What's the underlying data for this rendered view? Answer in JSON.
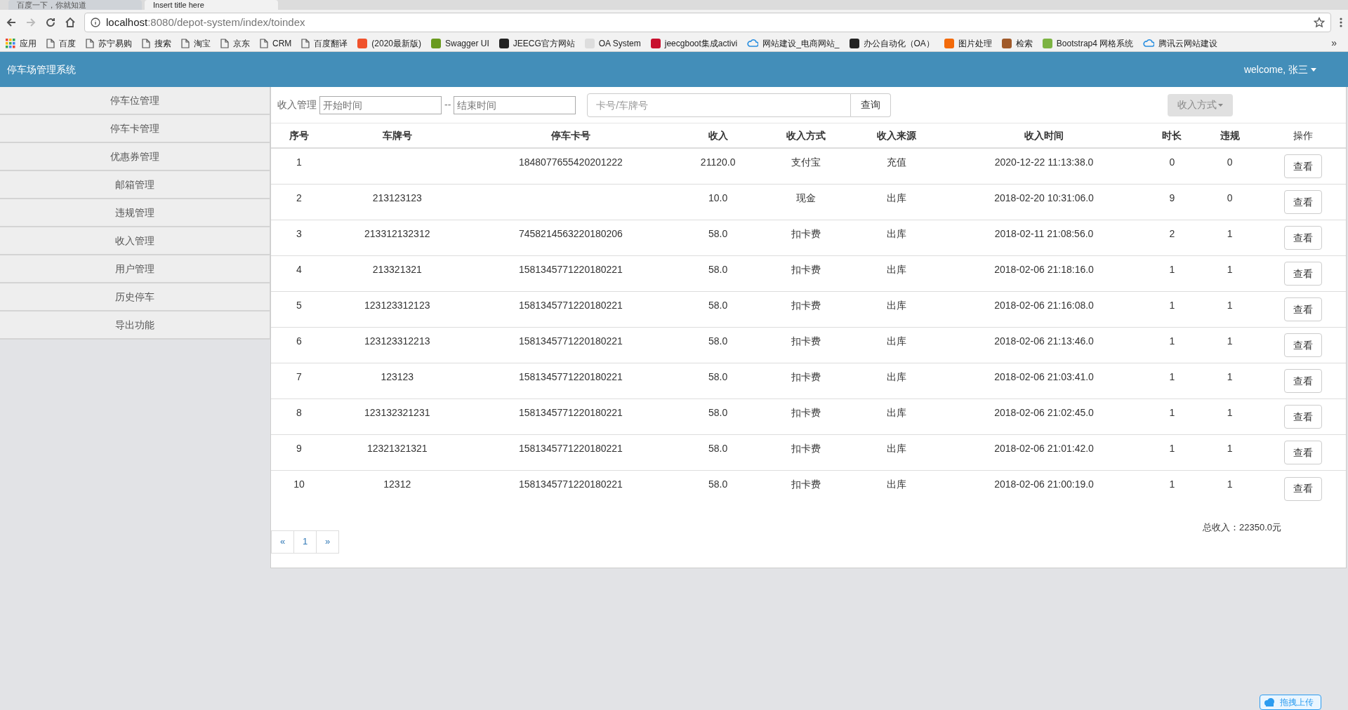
{
  "browser": {
    "tabs": [
      {
        "title": "百度一下，你就知道",
        "selected": false
      },
      {
        "title": "Insert title here",
        "selected": true
      }
    ],
    "url": {
      "host": "localhost",
      "rest": ":8080/depot-system/index/toindex"
    },
    "bookmarks": [
      {
        "label": "应用",
        "kind": "apps"
      },
      {
        "label": "百度",
        "kind": "page"
      },
      {
        "label": "苏宁易购",
        "kind": "page"
      },
      {
        "label": "搜索",
        "kind": "page"
      },
      {
        "label": "淘宝",
        "kind": "page"
      },
      {
        "label": "京东",
        "kind": "page"
      },
      {
        "label": "CRM",
        "kind": "page"
      },
      {
        "label": "百度翻译",
        "kind": "page"
      },
      {
        "label": "(2020最新版)",
        "kind": "site",
        "color": "#f0522c"
      },
      {
        "label": "Swagger UI",
        "kind": "site",
        "color": "#6a9a1f"
      },
      {
        "label": "JEECG官方网站",
        "kind": "site",
        "color": "#222222"
      },
      {
        "label": "OA System",
        "kind": "site",
        "color": "#dddddd"
      },
      {
        "label": "jeecgboot集成activi",
        "kind": "site",
        "color": "#c8102e"
      },
      {
        "label": "网站建设_电商网站_",
        "kind": "cloud",
        "color": "#2a8fe0"
      },
      {
        "label": "办公自动化（OA）",
        "kind": "site",
        "color": "#222222"
      },
      {
        "label": "图片处理",
        "kind": "site",
        "color": "#f36a0a"
      },
      {
        "label": "检索",
        "kind": "site",
        "color": "#a05a2a"
      },
      {
        "label": "Bootstrap4 网格系统",
        "kind": "site",
        "color": "#7cb342"
      },
      {
        "label": "腾讯云网站建设",
        "kind": "cloud",
        "color": "#2a8fe0"
      }
    ],
    "more": "»"
  },
  "header": {
    "title": "停车场管理系统",
    "user": "welcome, 张三"
  },
  "sidebar": {
    "items": [
      {
        "label": "停车位管理"
      },
      {
        "label": "停车卡管理"
      },
      {
        "label": "优惠券管理"
      },
      {
        "label": "邮箱管理"
      },
      {
        "label": "违规管理"
      },
      {
        "label": "收入管理"
      },
      {
        "label": "用户管理"
      },
      {
        "label": "历史停车"
      },
      {
        "label": "导出功能"
      }
    ]
  },
  "toolbar": {
    "label": "收入管理",
    "start": {
      "placeholder": "开始时间"
    },
    "separator": "--",
    "end": {
      "placeholder": "结束时间"
    },
    "search": {
      "placeholder": "卡号/车牌号"
    },
    "search_button": "查询",
    "dropdown": "收入方式"
  },
  "table": {
    "columns": [
      {
        "label": "序号",
        "bold": true
      },
      {
        "label": "车牌号",
        "bold": true
      },
      {
        "label": "停车卡号",
        "bold": true
      },
      {
        "label": "收入",
        "bold": true
      },
      {
        "label": "收入方式",
        "bold": true
      },
      {
        "label": "收入来源",
        "bold": true
      },
      {
        "label": "收入时间",
        "bold": true
      },
      {
        "label": "时长",
        "bold": true
      },
      {
        "label": "违规",
        "bold": true
      },
      {
        "label": "操作",
        "bold": false
      }
    ],
    "rows": [
      {
        "cells": [
          "1",
          "",
          "1848077655420201222",
          "21120.0",
          "支付宝",
          "充值",
          "2020-12-22 11:13:38.0",
          "0",
          "0"
        ],
        "action": "查看"
      },
      {
        "cells": [
          "2",
          "213123123",
          "",
          "10.0",
          "现金",
          "出库",
          "2018-02-20 10:31:06.0",
          "9",
          "0"
        ],
        "action": "查看"
      },
      {
        "cells": [
          "3",
          "213312132312",
          "7458214563220180206",
          "58.0",
          "扣卡费",
          "出库",
          "2018-02-11 21:08:56.0",
          "2",
          "1"
        ],
        "action": "查看"
      },
      {
        "cells": [
          "4",
          "213321321",
          "1581345771220180221",
          "58.0",
          "扣卡费",
          "出库",
          "2018-02-06 21:18:16.0",
          "1",
          "1"
        ],
        "action": "查看"
      },
      {
        "cells": [
          "5",
          "123123312123",
          "1581345771220180221",
          "58.0",
          "扣卡费",
          "出库",
          "2018-02-06 21:16:08.0",
          "1",
          "1"
        ],
        "action": "查看"
      },
      {
        "cells": [
          "6",
          "123123312213",
          "1581345771220180221",
          "58.0",
          "扣卡费",
          "出库",
          "2018-02-06 21:13:46.0",
          "1",
          "1"
        ],
        "action": "查看"
      },
      {
        "cells": [
          "7",
          "123123",
          "1581345771220180221",
          "58.0",
          "扣卡费",
          "出库",
          "2018-02-06 21:03:41.0",
          "1",
          "1"
        ],
        "action": "查看"
      },
      {
        "cells": [
          "8",
          "123132321231",
          "1581345771220180221",
          "58.0",
          "扣卡费",
          "出库",
          "2018-02-06 21:02:45.0",
          "1",
          "1"
        ],
        "action": "查看"
      },
      {
        "cells": [
          "9",
          "12321321321",
          "1581345771220180221",
          "58.0",
          "扣卡费",
          "出库",
          "2018-02-06 21:01:42.0",
          "1",
          "1"
        ],
        "action": "查看"
      },
      {
        "cells": [
          "10",
          "12312",
          "1581345771220180221",
          "58.0",
          "扣卡费",
          "出库",
          "2018-02-06 21:00:19.0",
          "1",
          "1"
        ],
        "action": "查看"
      }
    ]
  },
  "total": "总收入：22350.0元",
  "pagination": [
    {
      "label": "«",
      "selected": false
    },
    {
      "label": "1",
      "selected": false
    },
    {
      "label": "»",
      "selected": false
    }
  ],
  "upload_button": "拖拽上传"
}
